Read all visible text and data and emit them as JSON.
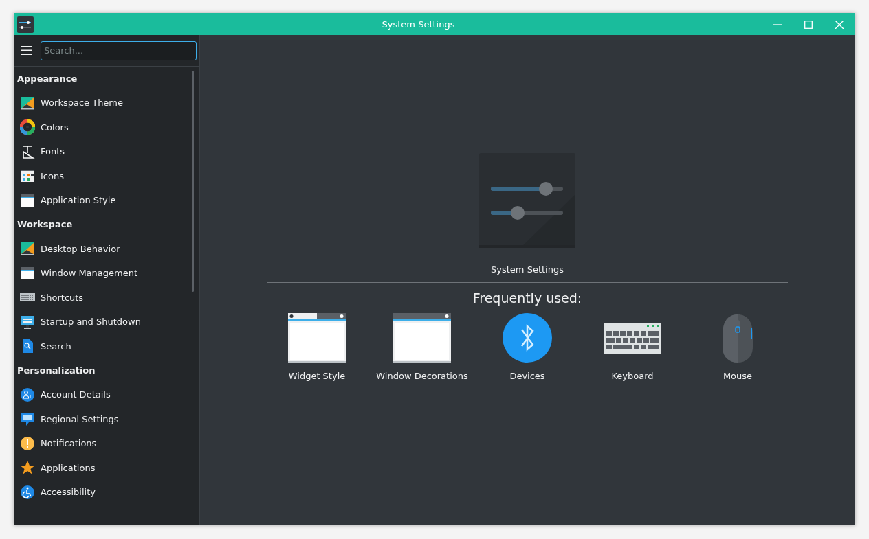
{
  "window": {
    "title": "System Settings"
  },
  "sidebar": {
    "search": {
      "placeholder": "Search..."
    },
    "sections": [
      {
        "title": "Appearance",
        "items": [
          {
            "label": "Workspace Theme"
          },
          {
            "label": "Colors"
          },
          {
            "label": "Fonts"
          },
          {
            "label": "Icons"
          },
          {
            "label": "Application Style"
          }
        ]
      },
      {
        "title": "Workspace",
        "items": [
          {
            "label": "Desktop Behavior"
          },
          {
            "label": "Window Management"
          },
          {
            "label": "Shortcuts"
          },
          {
            "label": "Startup and Shutdown"
          },
          {
            "label": "Search"
          }
        ]
      },
      {
        "title": "Personalization",
        "items": [
          {
            "label": "Account Details"
          },
          {
            "label": "Regional Settings"
          },
          {
            "label": "Notifications"
          },
          {
            "label": "Applications"
          },
          {
            "label": "Accessibility"
          }
        ]
      }
    ]
  },
  "main": {
    "app_label": "System Settings",
    "frequently_used_title": "Frequently used:",
    "frequently_used": [
      {
        "label": "Widget Style"
      },
      {
        "label": "Window Decorations"
      },
      {
        "label": "Devices"
      },
      {
        "label": "Keyboard"
      },
      {
        "label": "Mouse"
      }
    ]
  }
}
